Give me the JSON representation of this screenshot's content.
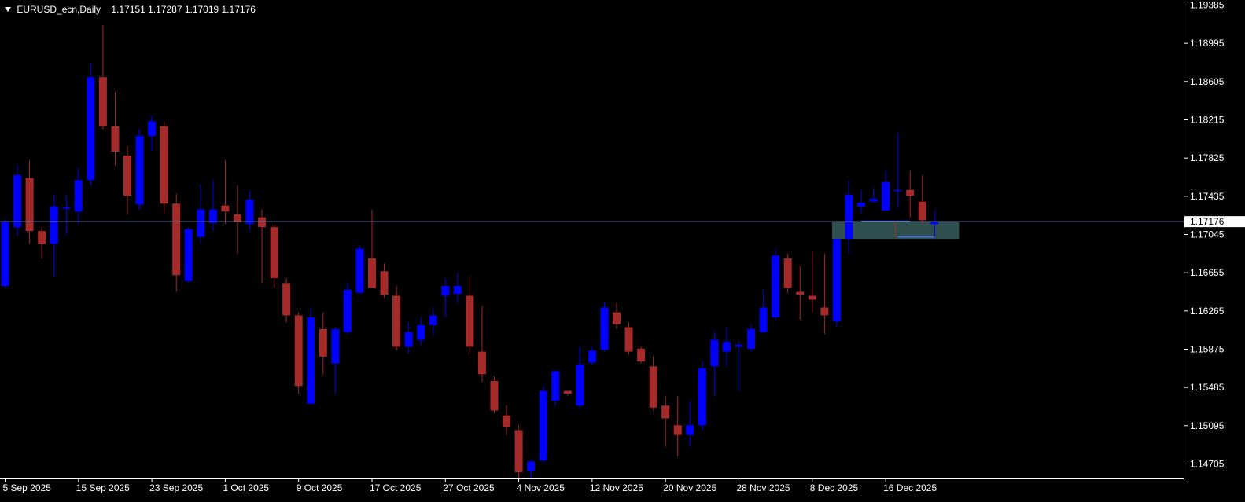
{
  "header": {
    "symbol": "EURUSD_ecn,Daily",
    "ohlc": "1.17151 1.17287 1.17019 1.17176"
  },
  "colors": {
    "background": "#000000",
    "bull": "#0000ff",
    "bear": "#a52a2a",
    "axis": "#ffffff",
    "current_price_line": "#6e7fa8",
    "zone_fill": "#2f4f4f",
    "price_tag_bg": "#ffffff",
    "price_tag_text": "#000000"
  },
  "chart_data": {
    "type": "candlestick",
    "timeframe": "Daily",
    "current_price": 1.17176,
    "current_price_label": "1.17176",
    "ylim": [
      1.1455,
      1.1945
    ],
    "y_ticks": [
      "1.19385",
      "1.18995",
      "1.18605",
      "1.18215",
      "1.17825",
      "1.17435",
      "1.17045",
      "1.16655",
      "1.16265",
      "1.15875",
      "1.15485",
      "1.15095",
      "1.14705"
    ],
    "x_labels": [
      {
        "label": "5 Sep 2025",
        "index": 0
      },
      {
        "label": "15 Sep 2025",
        "index": 6
      },
      {
        "label": "23 Sep 2025",
        "index": 12
      },
      {
        "label": "1 Oct 2025",
        "index": 18
      },
      {
        "label": "9 Oct 2025",
        "index": 24
      },
      {
        "label": "17 Oct 2025",
        "index": 30
      },
      {
        "label": "27 Oct 2025",
        "index": 36
      },
      {
        "label": "4 Nov 2025",
        "index": 42
      },
      {
        "label": "12 Nov 2025",
        "index": 48
      },
      {
        "label": "20 Nov 2025",
        "index": 54
      },
      {
        "label": "28 Nov 2025",
        "index": 60
      },
      {
        "label": "8 Dec 2025",
        "index": 66
      },
      {
        "label": "16 Dec 2025",
        "index": 72
      }
    ],
    "candles": [
      {
        "o": 1.1652,
        "h": 1.172,
        "l": 1.165,
        "c": 1.1718
      },
      {
        "o": 1.1712,
        "h": 1.1775,
        "l": 1.1703,
        "c": 1.1765
      },
      {
        "o": 1.1762,
        "h": 1.178,
        "l": 1.1695,
        "c": 1.1708
      },
      {
        "o": 1.1708,
        "h": 1.1712,
        "l": 1.168,
        "c": 1.1695
      },
      {
        "o": 1.1695,
        "h": 1.1745,
        "l": 1.1662,
        "c": 1.1733
      },
      {
        "o": 1.1732,
        "h": 1.1745,
        "l": 1.1705,
        "c": 1.1732
      },
      {
        "o": 1.1728,
        "h": 1.1772,
        "l": 1.1715,
        "c": 1.176
      },
      {
        "o": 1.176,
        "h": 1.188,
        "l": 1.1755,
        "c": 1.1865
      },
      {
        "o": 1.1865,
        "h": 1.1918,
        "l": 1.1812,
        "c": 1.1815
      },
      {
        "o": 1.1815,
        "h": 1.185,
        "l": 1.1775,
        "c": 1.1789
      },
      {
        "o": 1.1785,
        "h": 1.1795,
        "l": 1.1725,
        "c": 1.1744
      },
      {
        "o": 1.1735,
        "h": 1.1812,
        "l": 1.173,
        "c": 1.1805
      },
      {
        "o": 1.1805,
        "h": 1.1825,
        "l": 1.179,
        "c": 1.182
      },
      {
        "o": 1.1815,
        "h": 1.182,
        "l": 1.1726,
        "c": 1.1736
      },
      {
        "o": 1.1736,
        "h": 1.1746,
        "l": 1.1646,
        "c": 1.1663
      },
      {
        "o": 1.1657,
        "h": 1.1712,
        "l": 1.1655,
        "c": 1.171
      },
      {
        "o": 1.1702,
        "h": 1.1756,
        "l": 1.1695,
        "c": 1.173
      },
      {
        "o": 1.1716,
        "h": 1.176,
        "l": 1.1708,
        "c": 1.173
      },
      {
        "o": 1.1734,
        "h": 1.178,
        "l": 1.1715,
        "c": 1.1728
      },
      {
        "o": 1.1725,
        "h": 1.1755,
        "l": 1.1685,
        "c": 1.1717
      },
      {
        "o": 1.1715,
        "h": 1.175,
        "l": 1.1708,
        "c": 1.174
      },
      {
        "o": 1.1722,
        "h": 1.173,
        "l": 1.1655,
        "c": 1.1712
      },
      {
        "o": 1.1712,
        "h": 1.1715,
        "l": 1.165,
        "c": 1.166
      },
      {
        "o": 1.1655,
        "h": 1.166,
        "l": 1.1615,
        "c": 1.1622
      },
      {
        "o": 1.1622,
        "h": 1.1625,
        "l": 1.1542,
        "c": 1.155
      },
      {
        "o": 1.1532,
        "h": 1.163,
        "l": 1.1532,
        "c": 1.162
      },
      {
        "o": 1.1608,
        "h": 1.1625,
        "l": 1.1562,
        "c": 1.158
      },
      {
        "o": 1.1573,
        "h": 1.161,
        "l": 1.1542,
        "c": 1.1608
      },
      {
        "o": 1.1605,
        "h": 1.1655,
        "l": 1.1603,
        "c": 1.1648
      },
      {
        "o": 1.1645,
        "h": 1.1693,
        "l": 1.1645,
        "c": 1.169
      },
      {
        "o": 1.168,
        "h": 1.173,
        "l": 1.165,
        "c": 1.165
      },
      {
        "o": 1.1667,
        "h": 1.1675,
        "l": 1.164,
        "c": 1.1643
      },
      {
        "o": 1.1642,
        "h": 1.1652,
        "l": 1.1586,
        "c": 1.159
      },
      {
        "o": 1.159,
        "h": 1.1615,
        "l": 1.1583,
        "c": 1.1605
      },
      {
        "o": 1.1597,
        "h": 1.162,
        "l": 1.1592,
        "c": 1.1612
      },
      {
        "o": 1.1612,
        "h": 1.163,
        "l": 1.1602,
        "c": 1.1622
      },
      {
        "o": 1.1642,
        "h": 1.166,
        "l": 1.162,
        "c": 1.1652
      },
      {
        "o": 1.1644,
        "h": 1.1665,
        "l": 1.1635,
        "c": 1.1652
      },
      {
        "o": 1.1642,
        "h": 1.1662,
        "l": 1.1582,
        "c": 1.159
      },
      {
        "o": 1.1585,
        "h": 1.1632,
        "l": 1.1554,
        "c": 1.1562
      },
      {
        "o": 1.1555,
        "h": 1.156,
        "l": 1.1522,
        "c": 1.1525
      },
      {
        "o": 1.152,
        "h": 1.153,
        "l": 1.15,
        "c": 1.1508
      },
      {
        "o": 1.1505,
        "h": 1.151,
        "l": 1.1456,
        "c": 1.1462
      },
      {
        "o": 1.1463,
        "h": 1.1475,
        "l": 1.1455,
        "c": 1.1473
      },
      {
        "o": 1.1474,
        "h": 1.155,
        "l": 1.1472,
        "c": 1.1545
      },
      {
        "o": 1.1535,
        "h": 1.1565,
        "l": 1.153,
        "c": 1.1565
      },
      {
        "o": 1.1545,
        "h": 1.1545,
        "l": 1.154,
        "c": 1.1542
      },
      {
        "o": 1.153,
        "h": 1.159,
        "l": 1.1528,
        "c": 1.1572
      },
      {
        "o": 1.1574,
        "h": 1.159,
        "l": 1.1572,
        "c": 1.1586
      },
      {
        "o": 1.1587,
        "h": 1.1636,
        "l": 1.1585,
        "c": 1.163
      },
      {
        "o": 1.1625,
        "h": 1.1635,
        "l": 1.1608,
        "c": 1.1613
      },
      {
        "o": 1.161,
        "h": 1.1615,
        "l": 1.1582,
        "c": 1.1585
      },
      {
        "o": 1.1588,
        "h": 1.159,
        "l": 1.1573,
        "c": 1.1575
      },
      {
        "o": 1.157,
        "h": 1.158,
        "l": 1.1525,
        "c": 1.1528
      },
      {
        "o": 1.153,
        "h": 1.154,
        "l": 1.1488,
        "c": 1.1517
      },
      {
        "o": 1.151,
        "h": 1.154,
        "l": 1.1478,
        "c": 1.15
      },
      {
        "o": 1.15,
        "h": 1.1535,
        "l": 1.1488,
        "c": 1.151
      },
      {
        "o": 1.151,
        "h": 1.1575,
        "l": 1.1505,
        "c": 1.1568
      },
      {
        "o": 1.157,
        "h": 1.1605,
        "l": 1.154,
        "c": 1.1597
      },
      {
        "o": 1.1585,
        "h": 1.161,
        "l": 1.157,
        "c": 1.1595
      },
      {
        "o": 1.159,
        "h": 1.1595,
        "l": 1.1545,
        "c": 1.1592
      },
      {
        "o": 1.1588,
        "h": 1.1612,
        "l": 1.1585,
        "c": 1.1608
      },
      {
        "o": 1.1605,
        "h": 1.1648,
        "l": 1.1604,
        "c": 1.163
      },
      {
        "o": 1.162,
        "h": 1.169,
        "l": 1.1618,
        "c": 1.1683
      },
      {
        "o": 1.168,
        "h": 1.1685,
        "l": 1.1645,
        "c": 1.165
      },
      {
        "o": 1.1646,
        "h": 1.1672,
        "l": 1.1618,
        "c": 1.1643
      },
      {
        "o": 1.1642,
        "h": 1.1687,
        "l": 1.1625,
        "c": 1.1638
      },
      {
        "o": 1.163,
        "h": 1.1685,
        "l": 1.1603,
        "c": 1.1622
      },
      {
        "o": 1.1616,
        "h": 1.1689,
        "l": 1.161,
        "c": 1.17
      },
      {
        "o": 1.17,
        "h": 1.176,
        "l": 1.1685,
        "c": 1.1745
      },
      {
        "o": 1.1733,
        "h": 1.175,
        "l": 1.1726,
        "c": 1.1737
      },
      {
        "o": 1.1738,
        "h": 1.1752,
        "l": 1.1738,
        "c": 1.1741
      },
      {
        "o": 1.1729,
        "h": 1.177,
        "l": 1.1729,
        "c": 1.1758
      },
      {
        "o": 1.175,
        "h": 1.1808,
        "l": 1.1732,
        "c": 1.175
      },
      {
        "o": 1.175,
        "h": 1.177,
        "l": 1.1722,
        "c": 1.1744
      },
      {
        "o": 1.1738,
        "h": 1.1765,
        "l": 1.1715,
        "c": 1.1719
      },
      {
        "o": 1.1715,
        "h": 1.1729,
        "l": 1.1702,
        "c": 1.1718
      }
    ]
  },
  "zone": {
    "x0_index": 68,
    "x1_index": 78,
    "top": 1.1718,
    "bottom": 1.17
  },
  "marks": [
    {
      "type": "hline",
      "price": 1.1718,
      "x0_index": 70,
      "x1_index": 74,
      "color": "#4a6fff"
    },
    {
      "type": "hline",
      "price": 1.1702,
      "x0_index": 73,
      "x1_index": 76,
      "color": "#4a6fff"
    },
    {
      "type": "vline",
      "x_index": 73,
      "top": 1.1718,
      "bottom": 1.1702,
      "color": "#a52a2a"
    }
  ]
}
